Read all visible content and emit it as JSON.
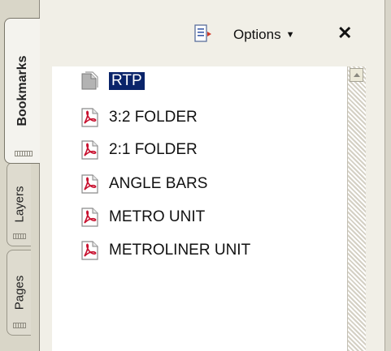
{
  "tabs": [
    {
      "label": "Bookmarks",
      "active": true
    },
    {
      "label": "Layers",
      "active": false
    },
    {
      "label": "Pages",
      "active": false
    }
  ],
  "header": {
    "options_label": "Options",
    "caret": "▼",
    "close_label": "✕",
    "options_icon": "options-menu-icon"
  },
  "bookmarks": [
    {
      "label": "RTP",
      "icon": "gray-page-icon",
      "selected": true
    },
    {
      "label": "3:2 FOLDER",
      "icon": "pdf-page-icon",
      "selected": false
    },
    {
      "label": "2:1 FOLDER",
      "icon": "pdf-page-icon",
      "selected": false
    },
    {
      "label": "ANGLE BARS",
      "icon": "pdf-page-icon",
      "selected": false
    },
    {
      "label": "METRO UNIT",
      "icon": "pdf-page-icon",
      "selected": false
    },
    {
      "label": "METROLINER UNIT",
      "icon": "pdf-page-icon",
      "selected": false
    }
  ],
  "colors": {
    "selection": "#0a246a",
    "pdf_red": "#c8102e",
    "panel_bg": "#f1efe7"
  }
}
